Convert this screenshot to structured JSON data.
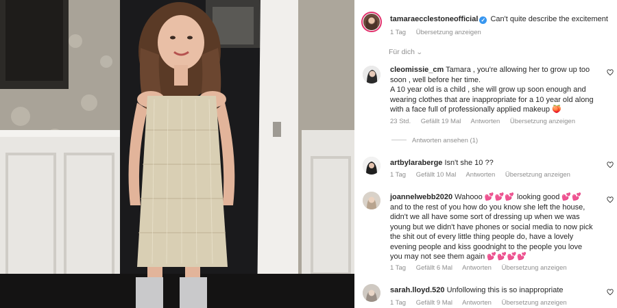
{
  "post": {
    "username": "tamaraecclestoneofficial",
    "caption": "Can't quite describe the excitement",
    "time": "1 Tag",
    "translate": "Übersetzung anzeigen"
  },
  "sort_label": "Für dich",
  "comments": [
    {
      "username": "cleomissie_cm",
      "text_1": "Tamara , you're allowing her to grow up too soon , well before her time.",
      "text_2": "A 10 year old is a child , she will grow up soon enough and wearing clothes that are inappropriate for a 10 year old along with a face full of professionally applied makeup",
      "emoji": "🍑",
      "time": "23 Std.",
      "likes": "Gefällt 19 Mal",
      "reply": "Antworten",
      "translate": "Übersetzung anzeigen",
      "view_replies": "Antworten ansehen (1)"
    },
    {
      "username": "artbylaraberge",
      "text": "Isn't she 10 ??",
      "time": "1 Tag",
      "likes": "Gefällt 10 Mal",
      "reply": "Antworten",
      "translate": "Übersetzung anzeigen"
    },
    {
      "username": "joannelwebb2020",
      "text_1": "Wahooo",
      "hearts_1": "💕💕💕",
      "text_2": "looking good",
      "hearts_2": "💕💕",
      "text_3": "and to the rest of you how do you know she left the house, didn't we all have some sort of dressing up when we was young but we didn't have phones or social media to now pick the shit out of every little thing people do, have a lovely evening people and kiss goodnight to the people you love you may not see them again",
      "hearts_3": "💕💕💕💕",
      "time": "1 Tag",
      "likes": "Gefällt 6 Mal",
      "reply": "Antworten",
      "translate": "Übersetzung anzeigen"
    },
    {
      "username": "sarah.lloyd.520",
      "text": "Unfollowing this is so inappropriate",
      "time": "1 Tag",
      "likes": "Gefällt 9 Mal",
      "reply": "Antworten",
      "translate": "Übersetzung anzeigen"
    }
  ],
  "colors": {
    "verified": "#3897f0",
    "story_ring": "#e1306c",
    "secondary_text": "#8e8e8e"
  },
  "icons": {
    "like": "heart-outline-icon",
    "verified": "verified-badge-icon",
    "sort": "chevron-down-icon"
  }
}
